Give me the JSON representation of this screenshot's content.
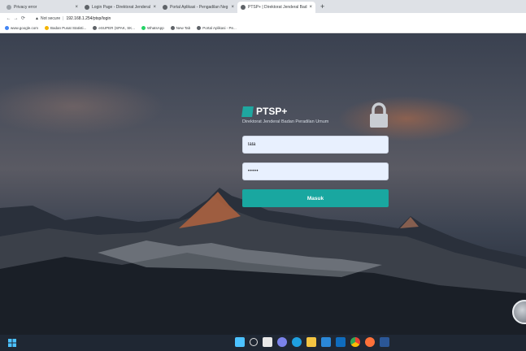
{
  "browser": {
    "tabs": [
      {
        "title": "Privacy error",
        "active": false
      },
      {
        "title": "Login Page - Direktorat Jenderal",
        "active": false
      },
      {
        "title": "Portal Aplikasi - Pengadilan Neg",
        "active": false
      },
      {
        "title": "PTSP+ | Direktorat Jenderal Bad",
        "active": true
      }
    ],
    "new_tab": "+",
    "security_label": "Not secure",
    "url": "192.168.1.254/ptsp/login",
    "bookmarks": [
      {
        "label": "www.google.com",
        "icon": "google-icon"
      },
      {
        "label": "Badan Pusat Statisti...",
        "icon": "bps-icon"
      },
      {
        "label": "eSUPER (SPAK, SK...",
        "icon": "esuper-icon"
      },
      {
        "label": "WhatsApp",
        "icon": "whatsapp-icon"
      },
      {
        "label": "New Tab",
        "icon": "globe-icon"
      },
      {
        "label": "Portal Aplikasi - Pe...",
        "icon": "globe-icon"
      }
    ]
  },
  "login": {
    "brand": "PTSP+",
    "subtitle": "Direktorat Jenderal Badan Peradilan Umum",
    "username_value": "lala",
    "password_value": "•••••",
    "submit_label": "Masuk"
  },
  "colors": {
    "accent": "#19a7a0",
    "field_bg": "#e8f0fe",
    "taskbar": "#1f2733"
  }
}
